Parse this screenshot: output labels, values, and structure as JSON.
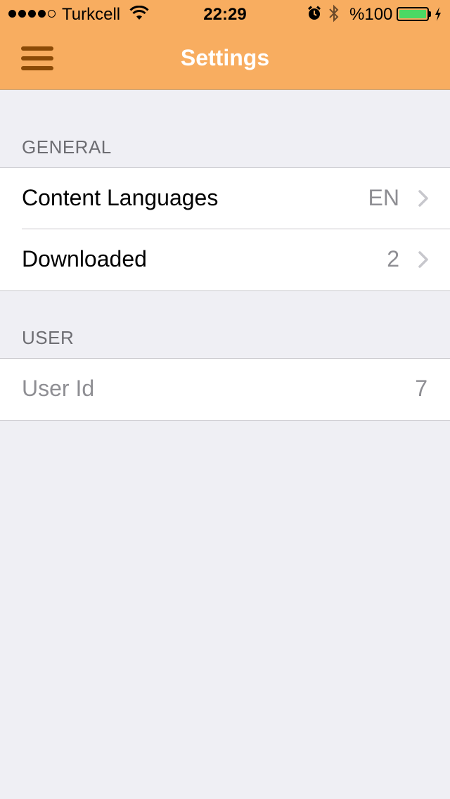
{
  "status_bar": {
    "carrier": "Turkcell",
    "time": "22:29",
    "battery_percent": "%100",
    "signal_bars": 4,
    "signal_max": 5,
    "wifi_icon": "wifi-icon",
    "alarm_icon": "alarm-icon",
    "bluetooth_icon": "bluetooth-icon",
    "battery_icon": "battery-icon",
    "charging_icon": "charging-bolt-icon",
    "battery_fill_color": "#4cd964"
  },
  "nav_bar": {
    "title": "Settings",
    "menu_icon": "hamburger-menu-icon",
    "background_color": "#f8ad60",
    "menu_icon_color": "#8b4a06"
  },
  "sections": [
    {
      "header": "GENERAL",
      "rows": [
        {
          "label": "Content Languages",
          "detail": "EN",
          "chevron": true
        },
        {
          "label": "Downloaded",
          "detail": "2",
          "chevron": true
        }
      ]
    },
    {
      "header": "USER",
      "rows": [
        {
          "label": "User Id",
          "detail": "7",
          "chevron": false
        }
      ]
    }
  ]
}
